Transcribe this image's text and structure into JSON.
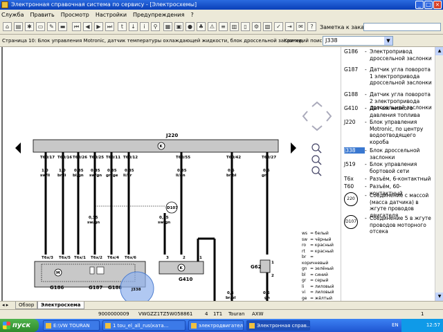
{
  "window": {
    "title": "Электронная справочная система по сервису - [Электросхемы]",
    "buttons": {
      "minimize": "_",
      "maximize": "□",
      "close": "×"
    }
  },
  "menu": [
    "Служба",
    "Править",
    "Просмотр",
    "Настройки",
    "Предупреждения",
    "?"
  ],
  "toolbar": {
    "note_label": "Заметка к заказу:",
    "note_value": ""
  },
  "search": {
    "page_info": "Страница 10: Блок управления Motronic, датчик температуры охлаждающей жидкости, блок дроссельной заслонки,",
    "criteria_label": "Критерий поиска:",
    "criteria_value": "J338"
  },
  "diagram": {
    "component_top": "J220",
    "component_top_sub": "220",
    "k_symbol": "K",
    "pins_top": [
      "T60/17",
      "T60/16",
      "T60/26",
      "T60/25",
      "T60/11",
      "T60/12",
      "T60/55",
      "T60/42",
      "T60/27"
    ],
    "wire_sizes_top": [
      "1,0",
      "1,0",
      "0,35",
      "0,35",
      "0,35",
      "0,35",
      "0,35",
      "0,5",
      "0,5"
    ],
    "wire_colors_top": [
      "sw/li",
      "br/li",
      "bl/gn",
      "sw/gn",
      "gn/ge",
      "li/br",
      "li/gn",
      "br/bl",
      "gn"
    ],
    "mid_wire_size": "0,35",
    "mid_wire_color": "sw/gn",
    "junction": "D107",
    "junction_wire_size": "0,35",
    "junction_wire_color": "sw/gn",
    "pins_bottom": [
      "T6x/3",
      "T6x/5",
      "T6x/1",
      "T6x/2",
      "T6x/4",
      "T6x/6"
    ],
    "pins_g410": [
      "3",
      "2",
      "1"
    ],
    "pins_g62": [
      "1",
      "2"
    ],
    "labels_bottom": [
      "G186",
      "G187",
      "G188",
      "J338",
      "G410",
      "G62"
    ],
    "bottom_wire_sizes": [
      "0,5",
      "0,5"
    ],
    "bottom_wire_colors": [
      "br/bl",
      "gn"
    ],
    "m_symbol": "M",
    "circle_highlight": "J338"
  },
  "colors_legend": [
    {
      "code": "ws",
      "name": "= белый"
    },
    {
      "code": "sw",
      "name": "= чёрный"
    },
    {
      "code": "ro",
      "name": "= красный"
    },
    {
      "code": "rt",
      "name": "= красный"
    },
    {
      "code": "br",
      "name": "= коричневый"
    },
    {
      "code": "gn",
      "name": "= зелёный"
    },
    {
      "code": "bl",
      "name": "= синий"
    },
    {
      "code": "gr",
      "name": "= серый"
    },
    {
      "code": "li",
      "name": "= лиловый"
    },
    {
      "code": "vi",
      "name": "= лиловый"
    },
    {
      "code": "ge",
      "name": "= жёлтый"
    },
    {
      "code": "or",
      "name": "= оранжевый"
    }
  ],
  "legend": [
    {
      "code": "G186",
      "desc": "Электропривод дроссельной заслонки"
    },
    {
      "code": "G187",
      "desc": "Датчик угла поворота 1 электропривода дроссельной заслонки"
    },
    {
      "code": "G188",
      "desc": "Датчик угла поворота 2 электропривода дроссельной заслонки"
    },
    {
      "code": "G410",
      "desc": "Датчик низкого давления топлива"
    },
    {
      "code": "J220",
      "desc": "Блок управления Motronic, по центру водоотводящего короба"
    },
    {
      "code": "J338",
      "desc": "Блок дроссельной заслонки"
    },
    {
      "code": "J519",
      "desc": "Блок управления бортовой сети"
    },
    {
      "code": "T6x",
      "desc": "Разъём, 6-контактный"
    },
    {
      "code": "T60",
      "desc": "Разъём, 60-контактный"
    },
    {
      "code": "220",
      "desc": "Соединение с массой (масса датчика) в жгуте проводов двигателя"
    },
    {
      "code": "D107",
      "desc": "Соединение 5 в жгуте проводов моторного отсека"
    }
  ],
  "legend_dash": "-",
  "tabs": [
    "Обзор",
    "Электросхема"
  ],
  "status": {
    "order": "9000000009",
    "vin": "VWGZZ1TZ5W058861",
    "n": "4",
    "engine_code": "1T1",
    "model": "Touran",
    "gearbox": "AXW",
    "page": "1"
  },
  "taskbar": {
    "start": "пуск",
    "tasks": [
      "E:\\VW TOURAN",
      "1 tou_el_all_rus(ката...",
      "электродвигатель пр...",
      "Электронная справ..."
    ],
    "lang": "EN",
    "clock": "12:57"
  }
}
